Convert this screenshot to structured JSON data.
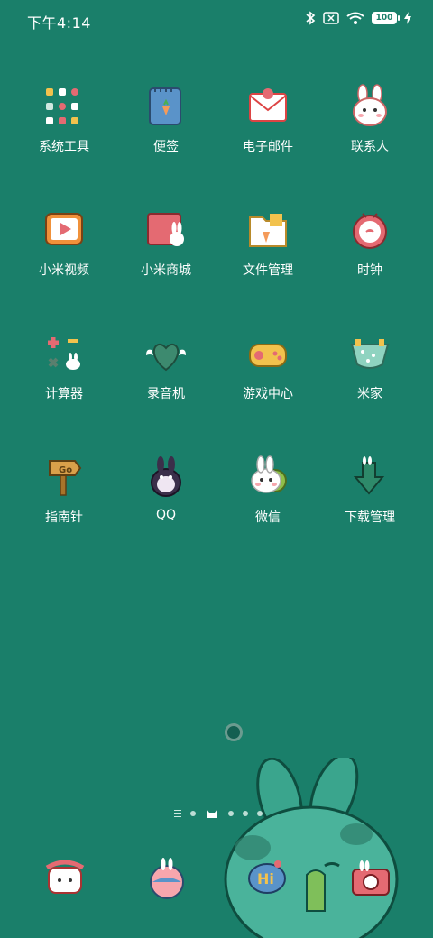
{
  "status_bar": {
    "time": "下午4:14",
    "battery": "100"
  },
  "apps": [
    {
      "label": "系统工具",
      "icon": "tools-grid-icon"
    },
    {
      "label": "便签",
      "icon": "notepad-icon"
    },
    {
      "label": "电子邮件",
      "icon": "envelope-icon"
    },
    {
      "label": "联系人",
      "icon": "bunny-contact-icon"
    },
    {
      "label": "小米视频",
      "icon": "video-play-icon"
    },
    {
      "label": "小米商城",
      "icon": "store-box-icon"
    },
    {
      "label": "文件管理",
      "icon": "folder-icon"
    },
    {
      "label": "时钟",
      "icon": "alarm-clock-icon"
    },
    {
      "label": "计算器",
      "icon": "calculator-icon"
    },
    {
      "label": "录音机",
      "icon": "winged-heart-icon"
    },
    {
      "label": "游戏中心",
      "icon": "gamepad-icon"
    },
    {
      "label": "米家",
      "icon": "home-cloth-icon"
    },
    {
      "label": "指南针",
      "icon": "signpost-icon"
    },
    {
      "label": "QQ",
      "icon": "penguin-bunny-icon"
    },
    {
      "label": "微信",
      "icon": "wechat-bunny-icon"
    },
    {
      "label": "下载管理",
      "icon": "download-arrow-icon"
    }
  ],
  "dock": [
    {
      "icon": "phone-bunny-icon"
    },
    {
      "icon": "globe-bunny-icon"
    },
    {
      "icon": "hi-chat-icon"
    },
    {
      "icon": "camera-bunny-icon"
    }
  ],
  "colors": {
    "wallpaper": "#1a7f6a",
    "accent_pink": "#e46a72",
    "accent_yellow": "#f2c24d"
  }
}
